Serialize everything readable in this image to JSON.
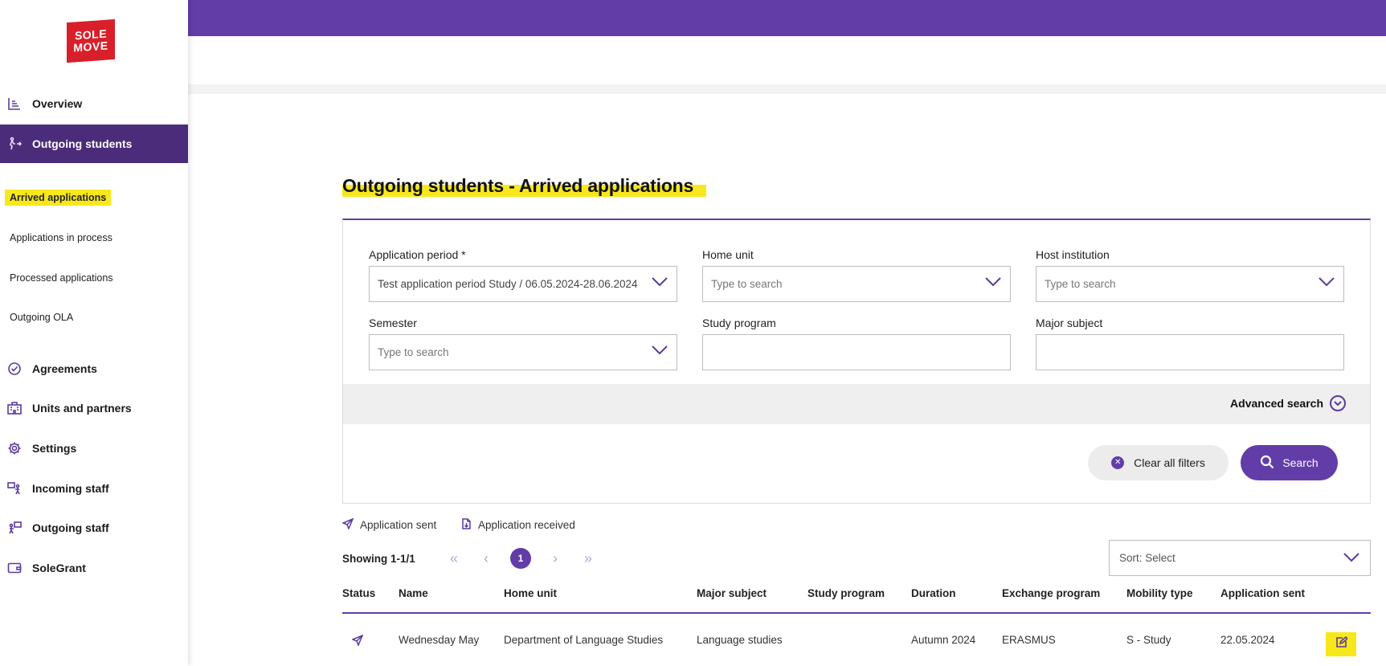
{
  "brand": {
    "logo_line1": "SOLE",
    "logo_line2": "MOVE",
    "accent": "#623da8",
    "highlight": "#f7e81c"
  },
  "sidebar": {
    "items": [
      {
        "label": "Overview",
        "icon": "chart-icon"
      },
      {
        "label": "Outgoing students",
        "icon": "walking-arrow-icon",
        "active": true
      },
      {
        "label": "Agreements",
        "icon": "check-circle-icon"
      },
      {
        "label": "Units and partners",
        "icon": "building-icon"
      },
      {
        "label": "Settings",
        "icon": "gear-icon"
      },
      {
        "label": "Incoming staff",
        "icon": "person-board-icon"
      },
      {
        "label": "Outgoing staff",
        "icon": "person-board-icon"
      },
      {
        "label": "SoleGrant",
        "icon": "wallet-icon"
      }
    ],
    "sub_items": [
      {
        "label": "Arrived applications",
        "active": true
      },
      {
        "label": "Applications in process"
      },
      {
        "label": "Processed applications"
      },
      {
        "label": "Outgoing OLA"
      }
    ]
  },
  "page": {
    "title": "Outgoing students - Arrived applications"
  },
  "filters": {
    "application_period": {
      "label": "Application period *",
      "value": "Test application period Study / 06.05.2024-28.06.2024"
    },
    "home_unit": {
      "label": "Home unit",
      "placeholder": "Type to search"
    },
    "host_institution": {
      "label": "Host institution",
      "placeholder": "Type to search"
    },
    "semester": {
      "label": "Semester",
      "placeholder": "Type to search"
    },
    "study_program": {
      "label": "Study program",
      "value": ""
    },
    "major_subject": {
      "label": "Major subject",
      "value": ""
    },
    "advanced_search": "Advanced search",
    "clear_all": "Clear all filters",
    "search": "Search"
  },
  "legend": {
    "sent": "Application sent",
    "received": "Application received"
  },
  "pagination": {
    "showing": "Showing 1-1/1",
    "current_page": "1"
  },
  "sort": {
    "label": "Sort: Select"
  },
  "table": {
    "headers": [
      "Status",
      "Name",
      "Home unit",
      "Major subject",
      "Study program",
      "Duration",
      "Exchange program",
      "Mobility type",
      "Application sent"
    ],
    "rows": [
      {
        "name": "Wednesday May",
        "home_unit": "Department of Language Studies",
        "major_subject": "Language studies",
        "study_program": "",
        "duration": "Autumn 2024",
        "exchange_program": "ERASMUS",
        "mobility_type": "S - Study",
        "application_sent": "22.05.2024"
      }
    ]
  }
}
